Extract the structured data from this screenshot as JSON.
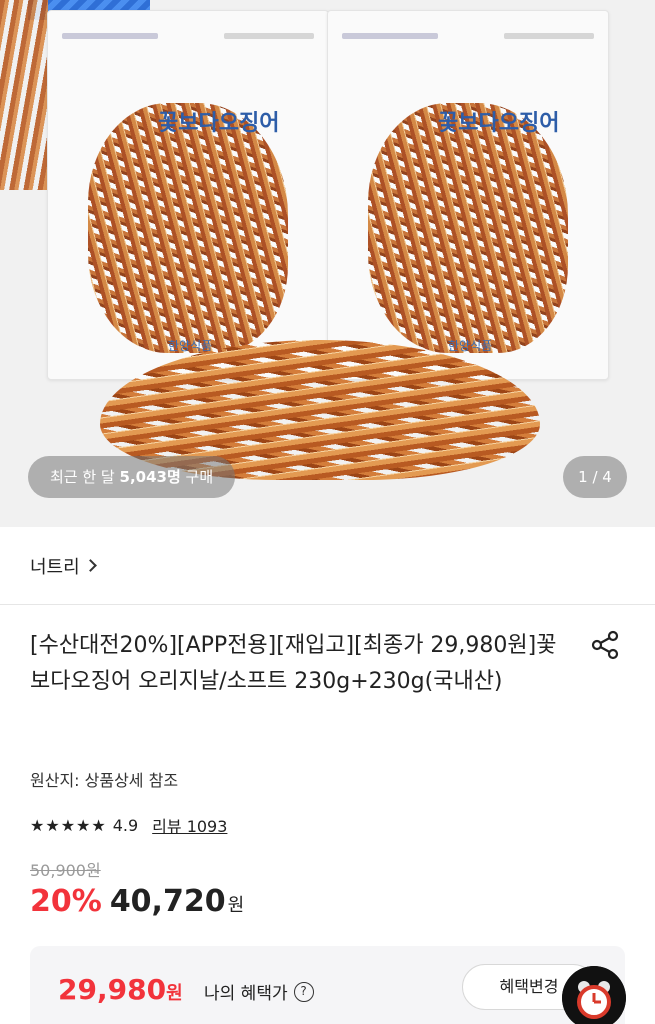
{
  "hero": {
    "package_brand": "꽃보다오징어",
    "package_maker": "한양식품",
    "purchase_badge_prefix": "최근 한 달 ",
    "purchase_badge_count": "5,043명",
    "purchase_badge_suffix": " 구매",
    "page_counter": "1 / 4"
  },
  "seller": {
    "name": "너트리"
  },
  "product": {
    "title": "[수산대전20%][APP전용][재입고][최종가 29,980원]꽃보다오징어 오리지날/소프트 230g+230g(국내산)",
    "origin": "원산지: 상품상세 참조",
    "stars": "★★★★★",
    "rating": "4.9",
    "review_link": "리뷰 1093",
    "original_price": "50,900원",
    "discount_rate": "20%",
    "sale_price": "40,720",
    "sale_currency": "원"
  },
  "benefit": {
    "price": "29,980",
    "currency": "원",
    "label": "나의 혜택가",
    "help_icon": "?",
    "change_button": "혜택변경"
  },
  "colors": {
    "accent_red": "#f2333b",
    "benefit_bg": "#f5f5f7"
  },
  "icons": {
    "share": "share-icon",
    "help": "question-circle-icon",
    "alarm": "alarm-clock-icon",
    "seller_arrow": "chevron-right-icon"
  }
}
